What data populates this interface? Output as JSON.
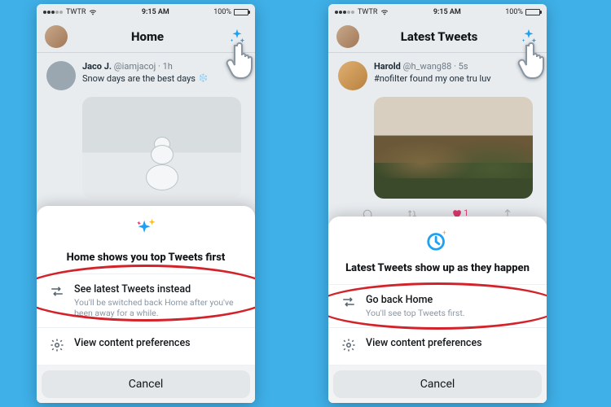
{
  "status": {
    "carrier": "TWTR",
    "time": "9:15 AM",
    "battery_pct": "100%"
  },
  "left": {
    "nav_title": "Home",
    "tweet": {
      "name": "Jaco J.",
      "handle": "@iamjacoj · 1h",
      "text": "Snow days are the best days"
    },
    "sheet": {
      "title": "Home shows you top Tweets first",
      "opt1_title": "See latest Tweets instead",
      "opt1_sub": "You'll be switched back Home after you've been away for a while.",
      "opt2_title": "View content preferences",
      "cancel": "Cancel"
    }
  },
  "right": {
    "nav_title": "Latest Tweets",
    "tweet": {
      "name": "Harold",
      "handle": "@h_wang88 · 5s",
      "text": "#nofilter found my one tru luv"
    },
    "sheet": {
      "title": "Latest Tweets show up as they happen",
      "opt1_title": "Go back Home",
      "opt1_sub": "You'll see top Tweets first.",
      "opt2_title": "View content preferences",
      "cancel": "Cancel"
    }
  },
  "like_count": "1"
}
